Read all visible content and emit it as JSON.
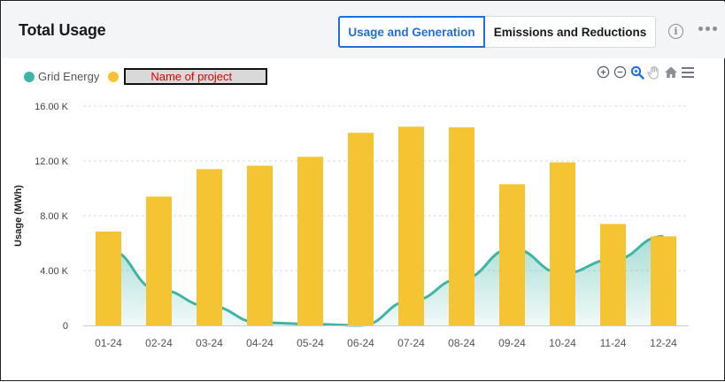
{
  "header": {
    "title": "Total Usage",
    "tabs": [
      {
        "label": "Usage and Generation",
        "active": true
      },
      {
        "label": "Emissions and Reductions",
        "active": false
      }
    ]
  },
  "icons": {
    "info": "info-icon",
    "more": "more-horizontal-icon",
    "toolbar": [
      "zoom-in-icon",
      "zoom-out-icon",
      "selection-zoom-icon",
      "pan-hand-icon",
      "reset-home-icon",
      "menu-icon"
    ]
  },
  "legend": {
    "grid_label": "Grid Energy",
    "grid_color": "#3fb5a5",
    "project_label": "Name of project",
    "project_color": "#f5c432"
  },
  "chart_data": {
    "type": "bar",
    "categories": [
      "01-24",
      "02-24",
      "03-24",
      "04-24",
      "05-24",
      "06-24",
      "07-24",
      "08-24",
      "09-24",
      "10-24",
      "11-24",
      "12-24"
    ],
    "ylabel": "Usage (MWh)",
    "ylim": [
      0,
      16000
    ],
    "yticks": [
      0,
      4000,
      8000,
      12000,
      16000
    ],
    "ytick_labels": [
      "0",
      "4.00 K",
      "8.00 K",
      "12.00 K",
      "16.00 K"
    ],
    "grid": true,
    "series": [
      {
        "name": "Name of project",
        "type": "bar",
        "color": "#f5c432",
        "values": [
          6850,
          9400,
          11400,
          11650,
          12300,
          14050,
          14500,
          14450,
          10300,
          11900,
          7400,
          6500
        ]
      },
      {
        "name": "Grid Energy",
        "type": "area",
        "color": "#3fb5a5",
        "values": [
          5500,
          2600,
          1400,
          200,
          100,
          0,
          1800,
          3400,
          5600,
          3800,
          4800,
          6500
        ]
      }
    ]
  }
}
